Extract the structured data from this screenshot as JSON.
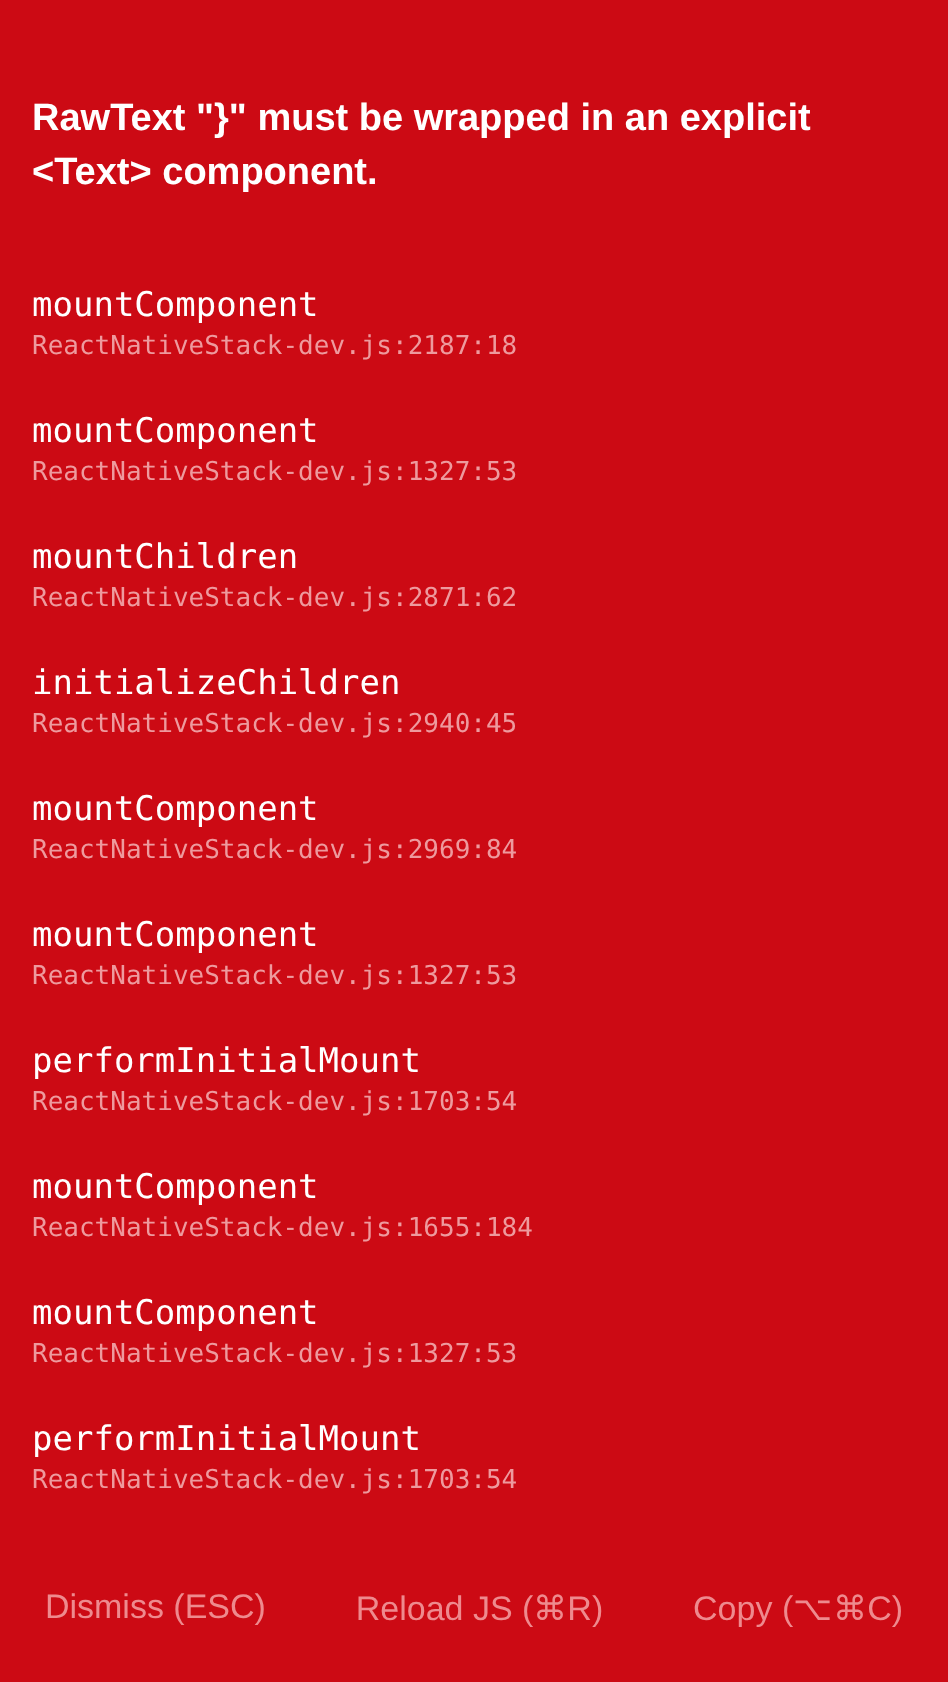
{
  "message": "RawText \"}\" must be wrapped in an explicit <Text> component.",
  "stack": [
    {
      "method": "mountComponent",
      "location": "ReactNativeStack-dev.js:2187:18"
    },
    {
      "method": "mountComponent",
      "location": "ReactNativeStack-dev.js:1327:53"
    },
    {
      "method": "mountChildren",
      "location": "ReactNativeStack-dev.js:2871:62"
    },
    {
      "method": "initializeChildren",
      "location": "ReactNativeStack-dev.js:2940:45"
    },
    {
      "method": "mountComponent",
      "location": "ReactNativeStack-dev.js:2969:84"
    },
    {
      "method": "mountComponent",
      "location": "ReactNativeStack-dev.js:1327:53"
    },
    {
      "method": "performInitialMount",
      "location": "ReactNativeStack-dev.js:1703:54"
    },
    {
      "method": "mountComponent",
      "location": "ReactNativeStack-dev.js:1655:184"
    },
    {
      "method": "mountComponent",
      "location": "ReactNativeStack-dev.js:1327:53"
    },
    {
      "method": "performInitialMount",
      "location": "ReactNativeStack-dev.js:1703:54"
    }
  ],
  "buttons": [
    "Dismiss (ESC)",
    "Reload JS (⌘R)",
    "Copy (⌥⌘C)"
  ]
}
